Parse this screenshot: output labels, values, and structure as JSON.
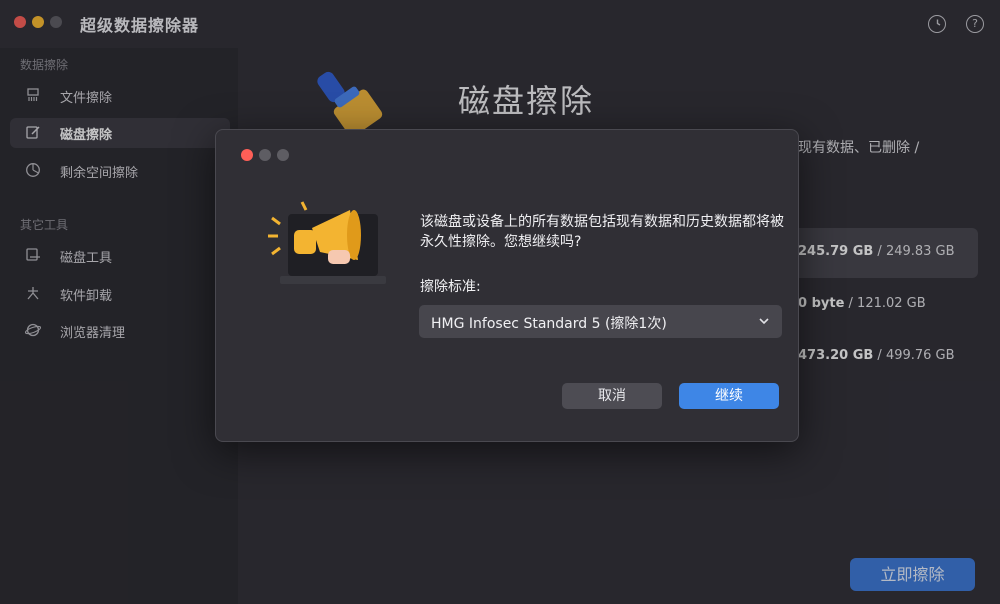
{
  "app": {
    "title": "超级数据擦除器"
  },
  "sidebar": {
    "section1": "数据擦除",
    "section2": "其它工具",
    "items": [
      {
        "label": "文件擦除",
        "icon": "shredder-icon"
      },
      {
        "label": "磁盘擦除",
        "icon": "disk-erase-icon",
        "active": true
      },
      {
        "label": "剩余空间擦除",
        "icon": "pie-chart-icon"
      },
      {
        "label": "磁盘工具",
        "icon": "disk-tool-icon"
      },
      {
        "label": "软件卸载",
        "icon": "uninstall-icon"
      },
      {
        "label": "浏览器清理",
        "icon": "browser-clean-icon"
      }
    ]
  },
  "main": {
    "title": "磁盘擦除",
    "description_tail": "现有数据、已删除 /",
    "disks": [
      {
        "used": "245.79 GB",
        "total": "249.83 GB",
        "selected": true
      },
      {
        "used": "0 byte",
        "total": "121.02 GB"
      },
      {
        "used": "473.20 GB",
        "total": "499.76 GB"
      }
    ],
    "start_button": "立即擦除"
  },
  "dialog": {
    "message": "该磁盘或设备上的所有数据包括现有数据和历史数据都将被永久性擦除。您想继续吗?",
    "standard_label": "擦除标准:",
    "standard_value": "HMG Infosec Standard 5 (擦除1次)",
    "cancel": "取消",
    "continue": "继续"
  },
  "colors": {
    "accent": "#3e86e6",
    "background": "#2f2e35",
    "sidebar": "#29282e"
  }
}
